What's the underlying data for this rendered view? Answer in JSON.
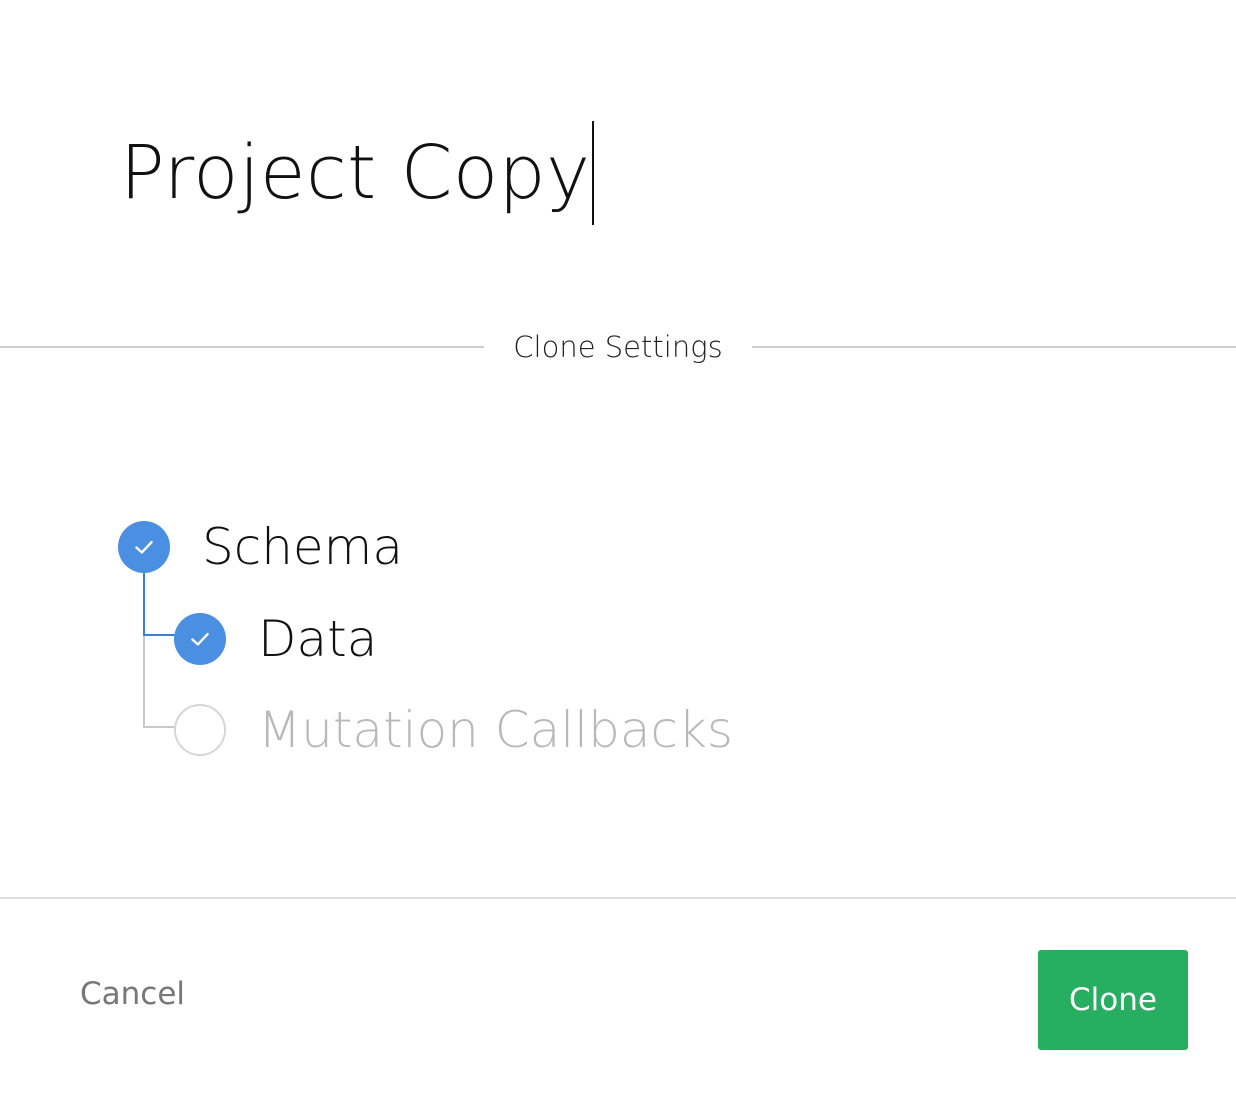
{
  "project": {
    "name": "Project Copy"
  },
  "settings": {
    "title": "Clone Settings",
    "options": [
      {
        "label": "Schema",
        "checked": true,
        "enabled": true
      },
      {
        "label": "Data",
        "checked": true,
        "enabled": true
      },
      {
        "label": "Mutation Callbacks",
        "checked": false,
        "enabled": false
      }
    ]
  },
  "footer": {
    "cancel_label": "Cancel",
    "clone_label": "Clone"
  },
  "colors": {
    "accent": "#4a8fe2",
    "tree_line_active": "#3a7fd4",
    "confirm": "#27ae60",
    "disabled_text": "#b9b9b9"
  }
}
